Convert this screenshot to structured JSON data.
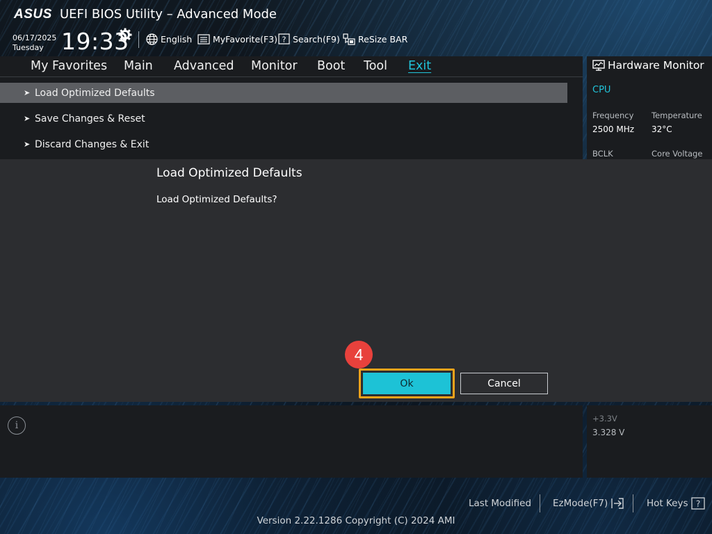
{
  "header": {
    "logo": "ASUS",
    "title": "UEFI BIOS Utility – Advanced Mode",
    "date": "06/17/2025",
    "day": "Tuesday",
    "time": "19:33",
    "buttons": [
      {
        "label": "English",
        "icon": "globe-icon"
      },
      {
        "label": "MyFavorite(F3)",
        "icon": "favorite-list-icon"
      },
      {
        "label": "Search(F9)",
        "icon": "search-help-icon"
      },
      {
        "label": "ReSize BAR",
        "icon": "resize-bar-icon"
      }
    ]
  },
  "nav": {
    "items": [
      "My Favorites",
      "Main",
      "Advanced",
      "Monitor",
      "Boot",
      "Tool",
      "Exit"
    ],
    "active": "Exit"
  },
  "menu": {
    "items": [
      {
        "label": "Load Optimized Defaults",
        "selected": true
      },
      {
        "label": "Save Changes & Reset",
        "selected": false
      },
      {
        "label": "Discard Changes & Exit",
        "selected": false
      }
    ]
  },
  "hardware_monitor": {
    "title": "Hardware Monitor",
    "section": "CPU",
    "frequency_label": "Frequency",
    "frequency_value": "2500 MHz",
    "temperature_label": "Temperature",
    "temperature_value": "32°C",
    "bclk_label": "BCLK",
    "core_voltage_label": "Core Voltage",
    "v33_label": "+3.3V",
    "v33_value": "3.328 V"
  },
  "dialog": {
    "title": "Load Optimized Defaults",
    "message": "Load Optimized Defaults?",
    "ok_label": "Ok",
    "cancel_label": "Cancel",
    "step_number": "4"
  },
  "footer": {
    "last_modified": "Last Modified",
    "ezmode": "EzMode(F7)",
    "hot_keys": "Hot Keys",
    "version": "Version 2.22.1286 Copyright (C) 2024 AMI"
  },
  "colors": {
    "accent": "#21c4da",
    "ok_button": "#1dc2d6",
    "highlight_border": "#f2a31b",
    "step_badge": "#e8413c",
    "dialog_bg": "#2c2d30"
  }
}
